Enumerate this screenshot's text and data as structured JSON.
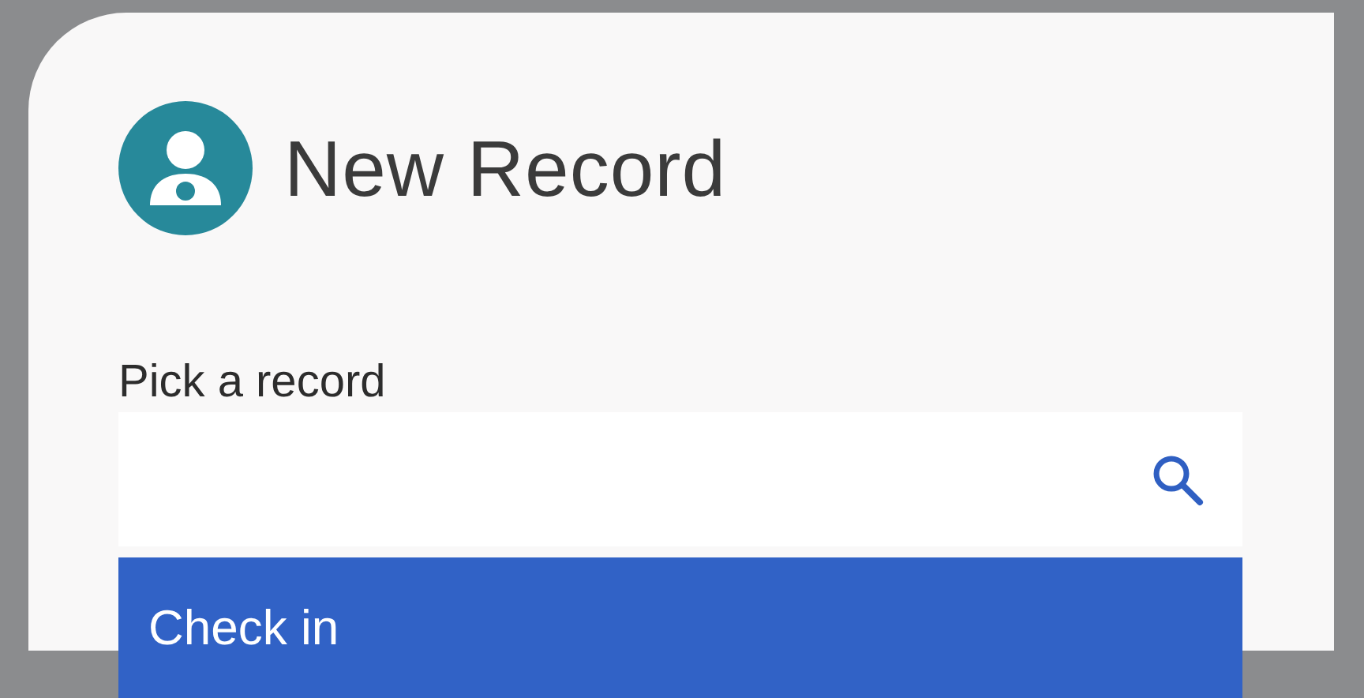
{
  "header": {
    "title": "New Record"
  },
  "field": {
    "label": "Pick a record"
  },
  "dropdown": {
    "options": [
      {
        "label": "Check in",
        "selected": true
      }
    ]
  }
}
